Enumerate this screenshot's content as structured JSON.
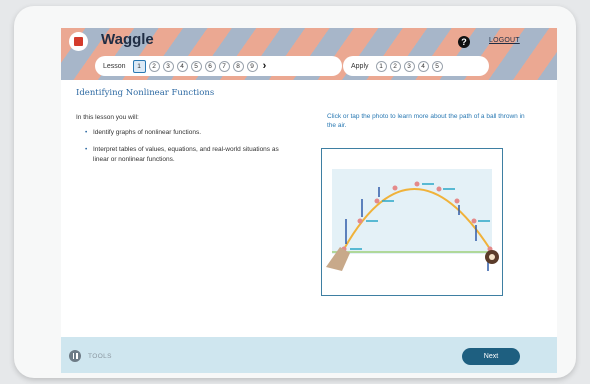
{
  "app": {
    "title": "Waggle",
    "logout_label": "LOGOUT",
    "help_glyph": "?"
  },
  "nav": {
    "lesson_label": "Lesson",
    "lesson_steps": [
      "1",
      "2",
      "3",
      "4",
      "5",
      "6",
      "7",
      "8",
      "9"
    ],
    "active_step": "1",
    "apply_label": "Apply",
    "apply_steps": [
      "1",
      "2",
      "3",
      "4",
      "5"
    ]
  },
  "content": {
    "title": "Identifying Nonlinear Functions",
    "intro": "In this lesson you will:",
    "bullets": [
      "Identify graphs of nonlinear functions.",
      "Interpret tables of values, equations, and real-world situations as linear or nonlinear functions."
    ],
    "photo_prompt": "Click or tap the photo to learn more about the path of a ball thrown in the air."
  },
  "footer": {
    "tools_label": "TOOLS",
    "next_label": "Next"
  },
  "colors": {
    "accent": "#2a79b3",
    "next_button": "#1e5f80",
    "footer_bg": "#cfe6ef",
    "logo": "#d43b2c"
  },
  "icons": [
    "logo-icon",
    "help-icon",
    "chevron-right-icon",
    "tools-pause-icon"
  ]
}
